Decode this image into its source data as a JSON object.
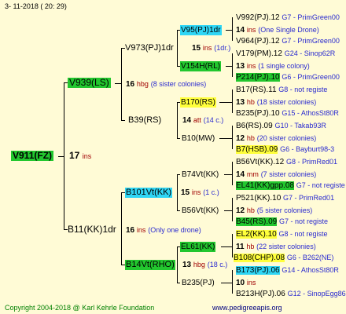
{
  "header": {
    "date": "3- 11-2018 ( 20: 29)"
  },
  "footer": {
    "copyright": "Copyright 2004-2018 @ Karl Kehrle Foundation",
    "website": "www.pedigreeapis.org"
  },
  "root": {
    "name": "V911(FZ)",
    "num": "17",
    "unit": "ins"
  },
  "gen1": [
    {
      "name": "V939(LS)",
      "num": "16",
      "unit": "hbg",
      "note": "(8 sister colonies)"
    },
    {
      "name": "B11(KK)1dr",
      "num": "16",
      "unit": "ins",
      "note": "(Only one drone)"
    }
  ],
  "gen2": [
    {
      "name": "V973(PJ)1dr",
      "num": "15",
      "unit": "ins",
      "note": "(1dr.)"
    },
    {
      "name": "B39(RS)",
      "num": "14",
      "unit": "att",
      "note": "(14 c.)"
    },
    {
      "name": "B101Vt(KK)",
      "num": "15",
      "unit": "ins",
      "note": "(1 c.)"
    },
    {
      "name": "B14Vt(RHO)",
      "num": "13",
      "unit": "hbg",
      "note": "(18 c.)"
    }
  ],
  "gen3": [
    {
      "name": "V95(PJ)1dr",
      "num": "14",
      "unit": "ins",
      "note": "(One Single Drone)"
    },
    {
      "name": "V154H(RL)",
      "num": "13",
      "unit": "ins",
      "note": "(1 single colony)"
    },
    {
      "name": "B170(RS)",
      "num": "13",
      "unit": "hb",
      "note": "(18 sister colonies)"
    },
    {
      "name": "B10(MW)",
      "num": "12",
      "unit": "hb",
      "note": "(20 sister colonies)"
    },
    {
      "name": "B74Vt(KK)",
      "num": "14",
      "unit": "mm",
      "note": "(7 sister colonies)"
    },
    {
      "name": "B56Vt(KK)",
      "num": "12",
      "unit": "hb",
      "note": "(5 sister colonies)"
    },
    {
      "name": "EL61(KK)",
      "num": "11",
      "unit": "hb",
      "note": "(22 sister colonies)"
    },
    {
      "name": "B235(PJ)",
      "num": "10",
      "unit": "ins",
      "note": ""
    }
  ],
  "gen4": [
    {
      "name": "V992(PJ).12",
      "note": "G7 - PrimGreen00"
    },
    {
      "name": "V964(PJ).12",
      "note": "G7 - PrimGreen00"
    },
    {
      "name": "V179(PM).12",
      "note": "G24 - Sinop62R"
    },
    {
      "name": "P214(PJ).10",
      "note": "G6 - PrimGreen00"
    },
    {
      "name": "B17(RS).11",
      "note": "G8 - not registe"
    },
    {
      "name": "B235(PJ).10",
      "note": "G15 - AthosSt80R"
    },
    {
      "name": "B6(RS).09",
      "note": "G10 - Takab93R"
    },
    {
      "name": "B7(HSB).09",
      "note": "G6 - Bayburt98-3"
    },
    {
      "name": "B56Vt(KK).12",
      "note": "G8 - PrimRed01"
    },
    {
      "name": "EL41(KK)gpp.08",
      "note": "G7 - not registe"
    },
    {
      "name": "P521(KK).10",
      "note": "G7 - PrimRed01"
    },
    {
      "name": "B45(RS).09",
      "note": "G7 - not registe"
    },
    {
      "name": "EL2(KK).10",
      "note": "G8 - not registe"
    },
    {
      "name": "B108(CHP).08",
      "note": "G6 - B262(NE)"
    },
    {
      "name": "B173(PJ).06",
      "note": "G14 - AthosSt80R"
    },
    {
      "name": "B213H(PJ).06",
      "note": "G12 - SinopEgg86R"
    }
  ]
}
